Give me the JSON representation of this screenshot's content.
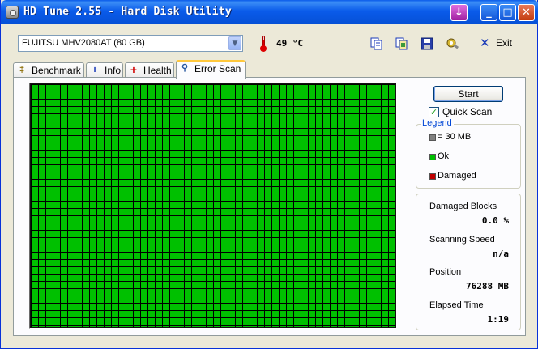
{
  "window": {
    "title": "HD Tune 2.55 - Hard Disk Utility"
  },
  "toolbar": {
    "drive": "FUJITSU MHV2080AT (80 GB)",
    "temperature": "49 °C",
    "exit_label": "Exit",
    "icons": [
      "copy-text-icon",
      "copy-screenshot-icon",
      "save-icon",
      "options-icon",
      "exit-icon"
    ]
  },
  "tabs": [
    {
      "label": "Benchmark",
      "icon": "benchmark-icon"
    },
    {
      "label": "Info",
      "icon": "info-icon"
    },
    {
      "label": "Health",
      "icon": "health-icon"
    },
    {
      "label": "Error Scan",
      "icon": "error-scan-icon",
      "active": true
    }
  ],
  "scan": {
    "start_label": "Start",
    "quick_scan_label": "Quick Scan",
    "quick_scan_checked": true,
    "block_status": "ok",
    "colors": {
      "ok": "#00c000",
      "damaged": "#c00000",
      "block": "#808080"
    }
  },
  "legend": {
    "title": "Legend",
    "block_size": "= 30 MB",
    "ok": "Ok",
    "damaged": "Damaged"
  },
  "stats": {
    "damaged_blocks_label": "Damaged Blocks",
    "damaged_blocks_value": "0.0 %",
    "scanning_speed_label": "Scanning Speed",
    "scanning_speed_value": "n/a",
    "position_label": "Position",
    "position_value": "76288 MB",
    "elapsed_label": "Elapsed Time",
    "elapsed_value": "1:19"
  }
}
